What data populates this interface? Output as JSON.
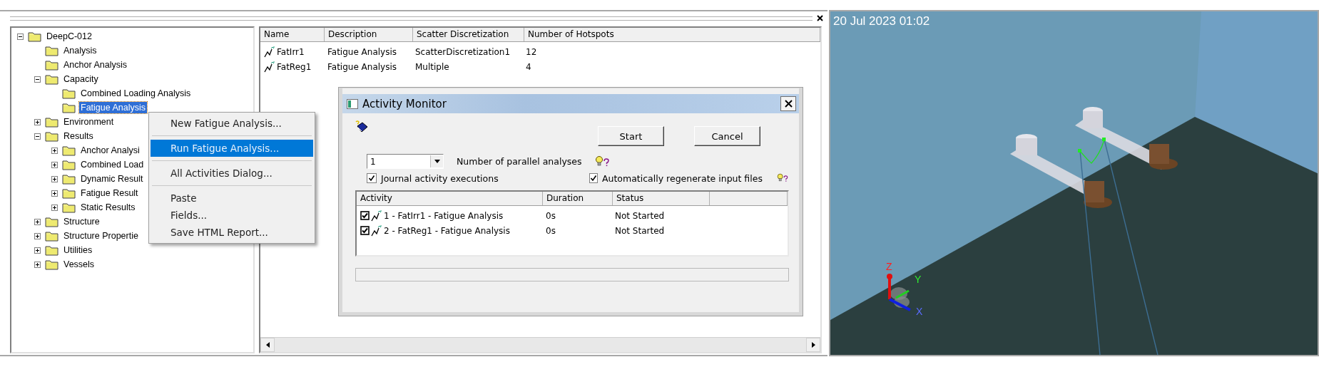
{
  "tree": [
    {
      "label": "DeepC-012",
      "expanded": true,
      "selected": false,
      "children": [
        {
          "label": "Analysis",
          "selected": false
        },
        {
          "label": "Anchor Analysis",
          "selected": false
        },
        {
          "label": "Capacity",
          "expanded": true,
          "selected": false,
          "children": [
            {
              "label": "Combined Loading Analysis",
              "selected": false
            },
            {
              "label": "Fatigue Analysis",
              "selected": true
            }
          ]
        },
        {
          "label": "Environment",
          "expanded": false,
          "selected": false
        },
        {
          "label": "Results",
          "expanded": true,
          "selected": false,
          "children": [
            {
              "label": "Anchor Analysi",
              "expanded": false,
              "selected": false
            },
            {
              "label": "Combined Load",
              "expanded": false,
              "selected": false
            },
            {
              "label": "Dynamic Result",
              "expanded": false,
              "selected": false
            },
            {
              "label": "Fatigue Result",
              "expanded": false,
              "selected": false
            },
            {
              "label": "Static Results",
              "expanded": false,
              "selected": false
            }
          ]
        },
        {
          "label": "Structure",
          "expanded": false,
          "selected": false
        },
        {
          "label": "Structure Propertie",
          "expanded": false,
          "selected": false
        },
        {
          "label": "Utilities",
          "expanded": false,
          "selected": false
        },
        {
          "label": "Vessels",
          "expanded": false,
          "selected": false
        }
      ]
    }
  ],
  "context_menu": [
    {
      "kind": "item",
      "label": "New Fatigue Analysis...",
      "selected": false
    },
    {
      "kind": "separator"
    },
    {
      "kind": "item",
      "label": "Run Fatigue Analysis...",
      "selected": true
    },
    {
      "kind": "separator"
    },
    {
      "kind": "item",
      "label": "All Activities Dialog...",
      "selected": false
    },
    {
      "kind": "separator"
    },
    {
      "kind": "item",
      "label": "Paste",
      "selected": false
    },
    {
      "kind": "item",
      "label": "Fields...",
      "selected": false
    },
    {
      "kind": "item",
      "label": "Save HTML Report...",
      "selected": false
    }
  ],
  "table": {
    "columns": [
      "Name",
      "Description",
      "Scatter Discretization",
      "Number of Hotspots"
    ],
    "rows": [
      {
        "cells": [
          "FatIrr1",
          "Fatigue Analysis",
          "ScatterDiscretization1",
          "12"
        ]
      },
      {
        "cells": [
          "FatReg1",
          "Fatigue Analysis",
          "Multiple",
          "4"
        ]
      }
    ]
  },
  "dialog": {
    "title": "Activity Monitor",
    "buttons": [
      "Start",
      "Cancel"
    ],
    "parallel": {
      "value": "1",
      "label": "Number of parallel analyses"
    },
    "options": [
      {
        "label": "Journal activity executions",
        "checked": true,
        "help": false
      },
      {
        "label": "Automatically regenerate input files",
        "checked": true,
        "help": true
      }
    ],
    "activities": {
      "columns": [
        "Activity",
        "Duration",
        "Status"
      ],
      "rows": [
        {
          "checked": true,
          "activity": "1 - FatIrr1 - Fatigue Analysis",
          "duration": "0s",
          "status": "Not Started"
        },
        {
          "checked": true,
          "activity": "2 - FatReg1 - Fatigue Analysis",
          "duration": "0s",
          "status": "Not Started"
        }
      ]
    }
  },
  "viewport": {
    "timestamp": "20 Jul 2023 01:02",
    "axes": [
      "Z",
      "Y",
      "X"
    ]
  }
}
